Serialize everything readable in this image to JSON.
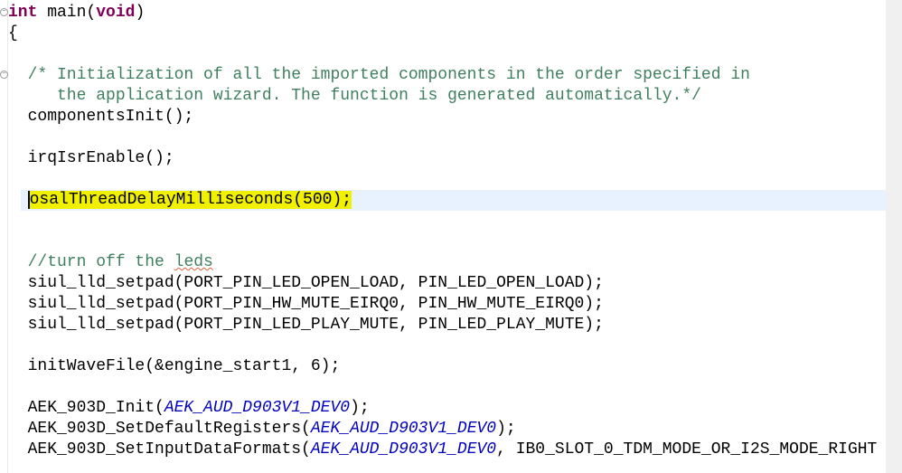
{
  "editor": {
    "lines": [
      {
        "fold": true,
        "segs": [
          {
            "t": "int",
            "c": "kw"
          },
          {
            "t": " main(",
            "c": ""
          },
          {
            "t": "void",
            "c": "kw"
          },
          {
            "t": ")",
            "c": ""
          }
        ]
      },
      {
        "segs": [
          {
            "t": "{",
            "c": ""
          }
        ]
      },
      {
        "segs": []
      },
      {
        "fold": true,
        "segs": [
          {
            "t": "  /* Initialization of all the imported components in the order specified in",
            "c": "cm"
          }
        ]
      },
      {
        "segs": [
          {
            "t": "     the application wizard. The function is generated automatically.*/",
            "c": "cm"
          }
        ]
      },
      {
        "segs": [
          {
            "t": "  componentsInit();",
            "c": ""
          }
        ]
      },
      {
        "segs": []
      },
      {
        "segs": [
          {
            "t": "  irqIsrEnable();",
            "c": ""
          }
        ]
      },
      {
        "segs": []
      },
      {
        "current": true,
        "segs": [
          {
            "t": "  ",
            "c": ""
          },
          {
            "t": "osalThreadDelayMilliseconds(500);",
            "c": "hl caret"
          }
        ]
      },
      {
        "segs": []
      },
      {
        "segs": []
      },
      {
        "segs": [
          {
            "t": "  //turn off the ",
            "c": "cm"
          },
          {
            "t": "leds",
            "c": "cm spell"
          }
        ]
      },
      {
        "segs": [
          {
            "t": "  siul_lld_setpad(PORT_PIN_LED_OPEN_LOAD, PIN_LED_OPEN_LOAD);",
            "c": ""
          }
        ]
      },
      {
        "segs": [
          {
            "t": "  siul_lld_setpad(PORT_PIN_HW_MUTE_EIRQ0, PIN_HW_MUTE_EIRQ0);",
            "c": ""
          }
        ]
      },
      {
        "segs": [
          {
            "t": "  siul_lld_setpad(PORT_PIN_LED_PLAY_MUTE, PIN_LED_PLAY_MUTE);",
            "c": ""
          }
        ]
      },
      {
        "segs": []
      },
      {
        "segs": [
          {
            "t": "  initWaveFile(&engine_start1, 6);",
            "c": ""
          }
        ]
      },
      {
        "segs": []
      },
      {
        "segs": [
          {
            "t": "  AEK_903D_Init(",
            "c": ""
          },
          {
            "t": "AEK_AUD_D903V1_DEV0",
            "c": "mac"
          },
          {
            "t": ");",
            "c": ""
          }
        ]
      },
      {
        "segs": [
          {
            "t": "  AEK_903D_SetDefaultRegisters(",
            "c": ""
          },
          {
            "t": "AEK_AUD_D903V1_DEV0",
            "c": "mac"
          },
          {
            "t": ");",
            "c": ""
          }
        ]
      },
      {
        "segs": [
          {
            "t": "  AEK_903D_SetInputDataFormats(",
            "c": ""
          },
          {
            "t": "AEK_AUD_D903V1_DEV0",
            "c": "mac"
          },
          {
            "t": ", IB0_SLOT_0_TDM_MODE_OR_I2S_MODE_RIGHT",
            "c": ""
          }
        ]
      }
    ]
  }
}
